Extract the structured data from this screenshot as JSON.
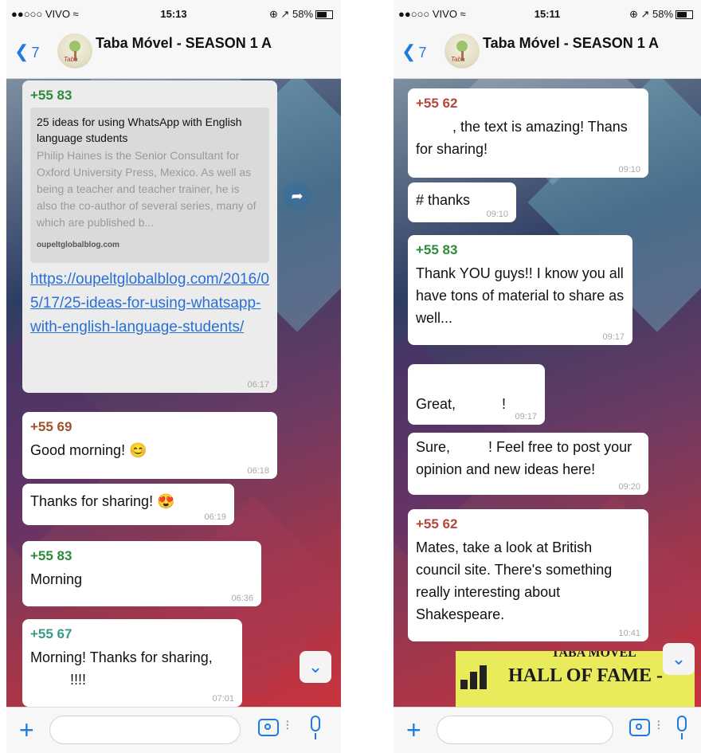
{
  "left": {
    "status": {
      "carrier": "●●○○○ VIVO ≈",
      "time": "15:13",
      "battery": "⊕ ↗ 58%"
    },
    "nav": {
      "back_count": "7",
      "title": "Taba Móvel - SEASON 1 A",
      "avatar_tag": "Taba"
    },
    "messages": [
      {
        "sender": "+55 83",
        "sender_color": "#2e8b3a",
        "preview_title": "25 ideas for using WhatsApp with English language students",
        "preview_desc": "Philip Haines is the Senior Consultant for Oxford University Press, Mexico. As well as being a teacher and teacher trainer, he is also the co-author of several series, many of which are published b...",
        "preview_site": "oupeltglobalblog.com",
        "link": "https://oupeltglobalblog.com/2016/05/17/25-ideas-for-using-whatsapp-with-english-language-students/",
        "time": "06:17"
      },
      {
        "sender": "+55 69",
        "sender_color": "#a0522d",
        "text": "Good morning! 😊",
        "time": "06:18"
      },
      {
        "text": "Thanks for sharing! 😍",
        "time": "06:19"
      },
      {
        "sender": "+55 83",
        "sender_color": "#2e8b3a",
        "text": "Morning",
        "time": "06:36"
      },
      {
        "sender": "+55 67",
        "sender_color": "#3a9a8a",
        "text": "Morning! Thanks for sharing,",
        "text2": "!!!!",
        "time": "07:01"
      }
    ]
  },
  "right": {
    "status": {
      "carrier": "●●○○○ VIVO ≈",
      "time": "15:11",
      "battery": "⊕ ↗ 58%"
    },
    "nav": {
      "back_count": "7",
      "title": "Taba Móvel - SEASON 1 A",
      "avatar_tag": "Taba"
    },
    "messages": [
      {
        "sender": "+55 62",
        "sender_color": "#b5473a",
        "text": ", the text is amazing! Thans for sharing!",
        "time": "09:10"
      },
      {
        "text": "# thanks",
        "time": "09:10"
      },
      {
        "sender": "+55 83",
        "sender_color": "#2e8b3a",
        "text": "Thank YOU guys!! I know you all have tons of material to share as well...",
        "time": "09:17"
      },
      {
        "text": "Great,",
        "text2": "!",
        "time": "09:17"
      },
      {
        "text": "Sure,",
        "text2": "! Feel free to post your opinion and new ideas here!",
        "time": "09:20"
      },
      {
        "sender": "+55 62",
        "sender_color": "#b5473a",
        "text": "Mates, take a look at British council site. There's something really interesting about Shakespeare.",
        "time": "10:41"
      }
    ],
    "image_caption": "HALL OF FAME -",
    "image_topline": "TABA MÓVEL"
  },
  "icons": {
    "back": "chevron-left-icon",
    "forward": "forward-icon",
    "scroll": "scroll-down-icon",
    "plus": "plus-icon",
    "camera": "camera-icon",
    "mic": "microphone-icon"
  },
  "colors": {
    "accent": "#1f7ae0",
    "bubble": "#ffffff",
    "hof_bg": "#e9eb5a"
  }
}
